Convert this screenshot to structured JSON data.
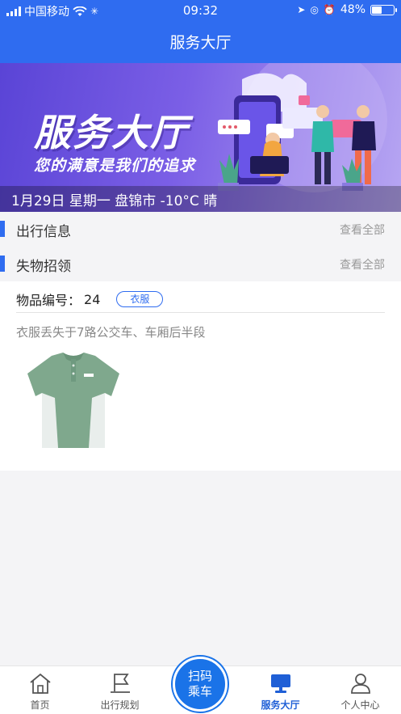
{
  "status_bar": {
    "carrier": "中国移动",
    "time": "09:32",
    "battery_percent": "48%",
    "battery_level": 0.48
  },
  "header": {
    "title": "服务大厅"
  },
  "banner": {
    "big_text": "服务大厅",
    "slogan": "您的满意是我们的追求",
    "weather": "1月29日 星期一 盘锦市 -10°C 晴"
  },
  "sections": {
    "travel_info": {
      "title": "出行信息",
      "more": "查看全部"
    },
    "lost_found": {
      "title": "失物招领",
      "more": "查看全部"
    }
  },
  "lost_item": {
    "number_label": "物品编号：",
    "number": "24",
    "category": "衣服",
    "description": "衣服丢失于7路公交车、车厢后半段"
  },
  "tabbar": {
    "home": "首页",
    "trip": "出行规划",
    "scan_line1": "扫码",
    "scan_line2": "乘车",
    "service": "服务大厅",
    "profile": "个人中心"
  },
  "colors": {
    "primary": "#2f6cf0",
    "scan_button": "#1a73e8",
    "shirt_green": "#7fa88d"
  }
}
